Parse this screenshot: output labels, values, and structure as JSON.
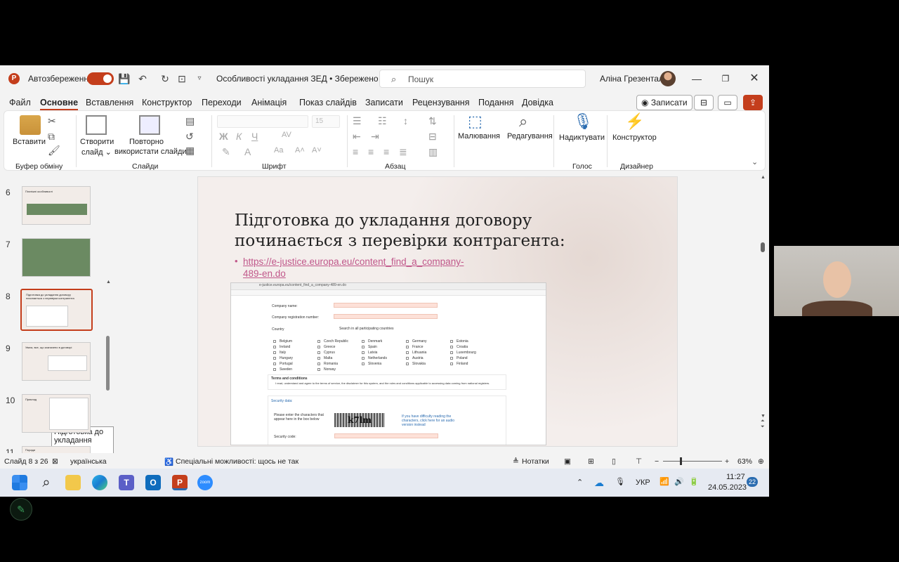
{
  "titlebar": {
    "autosave_label": "Автозбереження",
    "autosave_state": "Увімк.",
    "doc_title": "Особливості укладання ЗЕД • Збережено ⌄",
    "search_placeholder": "Пошук",
    "user_name": "Аліна Грезенталь"
  },
  "tabs": [
    "Файл",
    "Основне",
    "Вставлення",
    "Конструктор",
    "Переходи",
    "Анімація",
    "Показ слайдів",
    "Записати",
    "Рецензування",
    "Подання",
    "Довідка"
  ],
  "record_label": "Записати",
  "ribbon": {
    "paste": "Вставити",
    "clipboard_group": "Буфер обміну",
    "new_slide": "Створити",
    "new_slide2": "слайд ⌄",
    "reuse": "Повторно",
    "reuse2": "використати слайди",
    "slides_group": "Слайди",
    "font_group": "Шрифт",
    "font_size": "15",
    "paragraph_group": "Абзац",
    "drawing": "Малювання",
    "editing": "Редагування",
    "dictate": "Надиктувати",
    "voice_group": "Голос",
    "designer": "Конструктор",
    "designer_group": "Дизайнер"
  },
  "thumbnails": [
    {
      "num": "6",
      "title": "Платіжні особливості"
    },
    {
      "num": "7",
      "title": ""
    },
    {
      "num": "8",
      "title": "Підготовка до укладання договору починається з перевірки контрагента"
    },
    {
      "num": "9",
      "title": "Увага, все, що зазначено в договорі"
    },
    {
      "num": "10",
      "title": "Приклад"
    },
    {
      "num": "11",
      "title": "Поради"
    }
  ],
  "tooltip": "Підготовка до укладання договор...",
  "slide": {
    "title": "Підготовка до укладання договору починається з перевірки контрагента:",
    "bullet": "•",
    "link": "https://e-justice.europa.eu/content_find_a_company-489-en.do",
    "form": {
      "company_name": "Company name:",
      "reg_number": "Company registration number:",
      "country": "Country",
      "search_all": "Search in all participating countries",
      "countries": [
        "Belgium",
        "Czech Republic",
        "Denmark",
        "Germany",
        "Estonia",
        "Ireland",
        "Greece",
        "Spain",
        "France",
        "Croatia",
        "Italy",
        "Cyprus",
        "Latvia",
        "Lithuania",
        "Luxembourg",
        "Hungary",
        "Malta",
        "Netherlands",
        "Austria",
        "Poland",
        "Portugal",
        "Romania",
        "Slovenia",
        "Slovakia",
        "Finland",
        "Sweden",
        "Norway"
      ],
      "terms_title": "Terms and conditions",
      "terms_text": "I read, understand and agree to the terms of service, the disclaimer for this system, and the rules and conditions applicable to accessing data coming from national registers.",
      "security_title": "Security data:",
      "captcha_prompt": "Please enter the characters that appear here in the box below",
      "captcha_text": "k7lm",
      "captcha_help": "If you have difficulty reading the characters, click here for an audio version instead",
      "security_code": "Security code:"
    }
  },
  "status": {
    "slide_of": "Слайд 8 з 26",
    "language": "українська",
    "accessibility": "Спеціальні можливості: щось не так",
    "notes": "Нотатки",
    "zoom": "63%"
  },
  "taskbar": {
    "lang": "УКР",
    "time": "11:27",
    "date": "24.05.2023",
    "badge": "22",
    "zoom_app": "zoom"
  }
}
